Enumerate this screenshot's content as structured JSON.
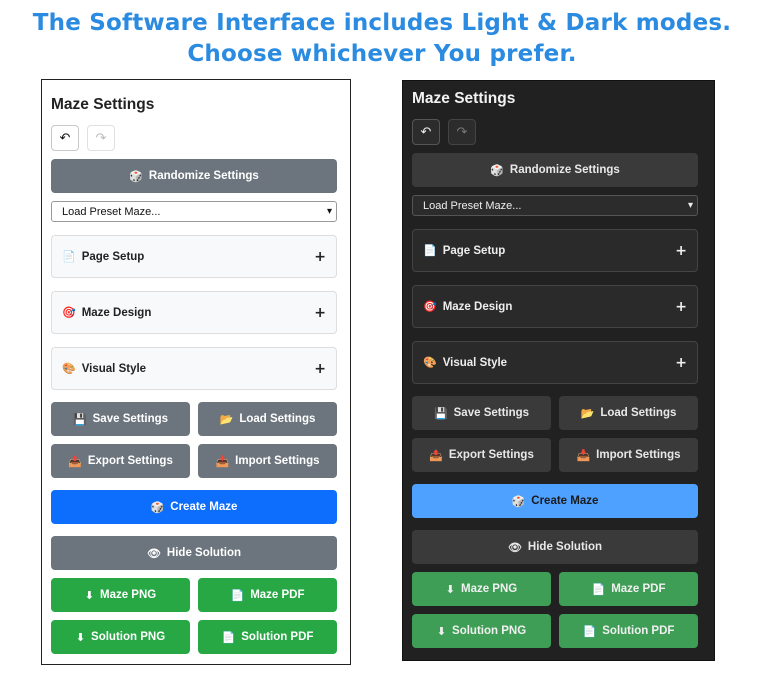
{
  "headline": {
    "line1": "The Software Interface includes Light & Dark modes.",
    "line2": "Choose whichever You prefer."
  },
  "panel": {
    "title": "Maze Settings",
    "undo_icon": "↶",
    "redo_icon": "↷",
    "randomize": {
      "icon": "🎲",
      "label": "Randomize Settings"
    },
    "preset_select": {
      "value": "Load Preset Maze...",
      "chevron": "▾"
    },
    "sections": [
      {
        "icon": "📄",
        "label": "Page Setup",
        "toggle": "+"
      },
      {
        "icon": "🎯",
        "label": "Maze Design",
        "toggle": "+"
      },
      {
        "icon": "🎨",
        "label": "Visual Style",
        "toggle": "+"
      }
    ],
    "save": {
      "icon": "💾",
      "label": "Save Settings"
    },
    "load": {
      "icon": "📂",
      "label": "Load Settings"
    },
    "export": {
      "icon": "📤",
      "label": "Export Settings"
    },
    "import": {
      "icon": "📥",
      "label": "Import Settings"
    },
    "create": {
      "icon": "🎲",
      "label": "Create Maze"
    },
    "hide_solution": {
      "icon": "👁",
      "label": "Hide Solution"
    },
    "maze_png": {
      "icon": "⬇",
      "label": "Maze PNG"
    },
    "maze_pdf": {
      "icon": "📄",
      "label": "Maze PDF"
    },
    "solution_png": {
      "icon": "⬇",
      "label": "Solution PNG"
    },
    "solution_pdf": {
      "icon": "📄",
      "label": "Solution PDF"
    }
  },
  "colors": {
    "headline": "#2a8be0",
    "light_primary": "#0d6efd",
    "light_success": "#28a745",
    "light_secondary": "#6c757d",
    "dark_background": "#212121",
    "dark_primary": "#4ea1ff",
    "dark_success": "#3f9e56"
  }
}
